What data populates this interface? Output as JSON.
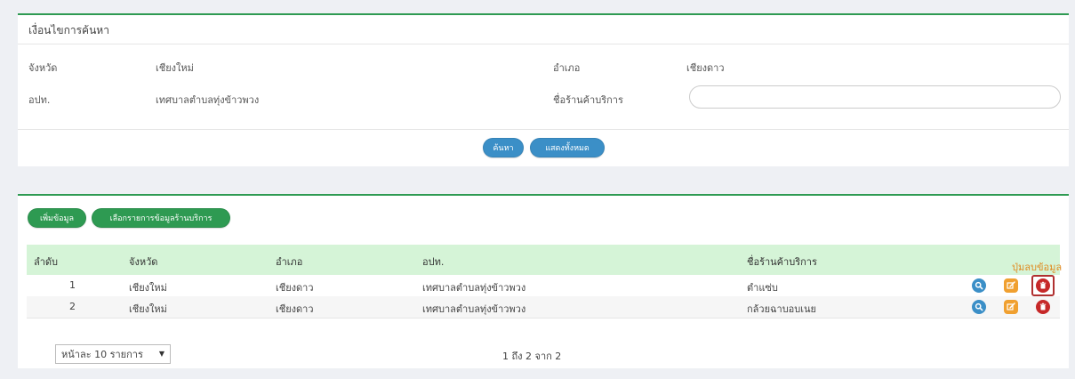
{
  "search": {
    "title": "เงื่อนไขการค้นหา",
    "province_label": "จังหวัด",
    "province_value": "เชียงใหม่",
    "district_label": "อำเภอ",
    "district_value": "เชียงดาว",
    "lao_label": "อปท.",
    "lao_value": "เทศบาลตำบลทุ่งข้าวพวง",
    "shop_label": "ชื่อร้านค้าบริการ",
    "shop_value": "",
    "search_button": "ค้นหา",
    "show_all_button": "แสดงทั้งหมด"
  },
  "results": {
    "add_button": "เพิ่มข้อมูล",
    "choose_button": "เลือกรายการข้อมูลร้านบริการ",
    "columns": [
      "ลำดับ",
      "จังหวัด",
      "อำเภอ",
      "อปท.",
      "ชื่อร้านค้าบริการ"
    ],
    "rows": [
      {
        "no": "1",
        "province": "เชียงใหม่",
        "district": "เชียงดาว",
        "lao": "เทศบาลตำบลทุ่งข้าวพวง",
        "shop": "ตำแซ่บ"
      },
      {
        "no": "2",
        "province": "เชียงใหม่",
        "district": "เชียงดาว",
        "lao": "เทศบาลตำบลทุ่งข้าวพวง",
        "shop": "กล้วยฉาบอบเนย"
      }
    ],
    "delete_callout": "ปุ่มลบข้อมูล",
    "page_size": "หน้าละ 10 รายการ",
    "page_info": "1 ถึง 2 จาก 2"
  },
  "icons": {
    "view": "search-icon",
    "edit": "edit-icon",
    "delete": "trash-icon"
  },
  "colors": {
    "accent_green": "#2e9a52",
    "button_blue": "#3b8fc7",
    "header_green": "#d5f4d7",
    "edit_orange": "#f0a030",
    "delete_red": "#c62828",
    "callout_orange": "#e08a20"
  }
}
